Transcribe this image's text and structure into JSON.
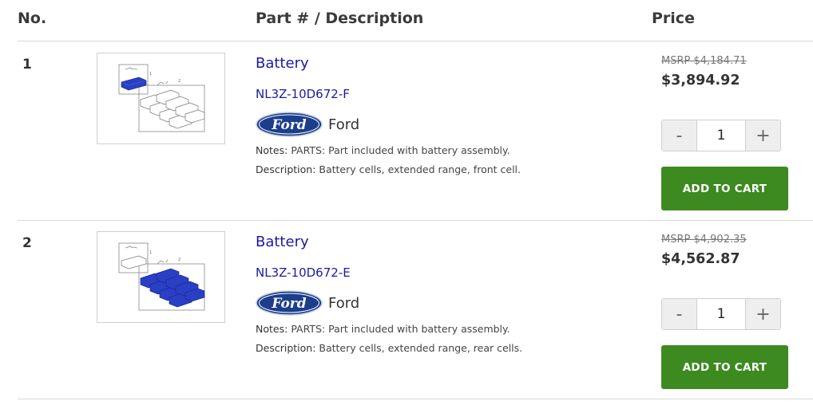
{
  "header": {
    "no": "No.",
    "part": "Part # / Description",
    "price": "Price"
  },
  "rows": [
    {
      "number": "1",
      "name": "Battery",
      "part_number": "NL3Z-10D672-F",
      "brand": "Ford",
      "notes_label": "Notes:",
      "notes": "PARTS: Part included with battery assembly.",
      "description_label": "Description:",
      "description": "Battery cells, extended range, front cell.",
      "msrp": "MSRP $4,184.71",
      "price": "$3,894.92",
      "quantity": "1",
      "highlight": "front"
    },
    {
      "number": "2",
      "name": "Battery",
      "part_number": "NL3Z-10D672-E",
      "brand": "Ford",
      "notes_label": "Notes:",
      "notes": "PARTS: Part included with battery assembly.",
      "description_label": "Description:",
      "description": "Battery cells, extended range, rear cells.",
      "msrp": "MSRP $4,902.35",
      "price": "$4,562.87",
      "quantity": "1",
      "highlight": "rear"
    }
  ],
  "controls": {
    "minus": "-",
    "plus": "+",
    "add_to_cart": "ADD TO CART"
  },
  "logo_text": "Ford",
  "colors": {
    "link": "#1a1aa6",
    "cart_button": "#3d8a20",
    "highlight_blue": "#2a3fc4",
    "ford_blue": "#1c3e8c"
  }
}
